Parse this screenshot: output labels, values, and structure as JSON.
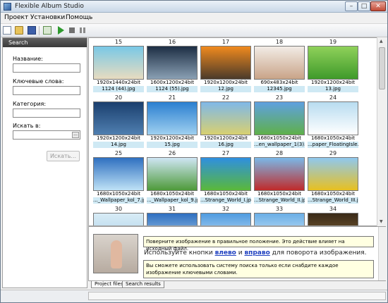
{
  "window": {
    "title": "Flexible Album Studio"
  },
  "menu": [
    "Проект",
    "Установки",
    "Помощь"
  ],
  "sidebar": {
    "header": "Search",
    "fields": [
      {
        "label": "Название:",
        "value": ""
      },
      {
        "label": "Ключевые слова:",
        "value": ""
      },
      {
        "label": "Категория:",
        "value": ""
      },
      {
        "label": "Искать в:",
        "value": ""
      }
    ],
    "browse_label": "...",
    "search_button": "Искать..."
  },
  "gallery": {
    "rows": [
      [
        {
          "num": "15",
          "meta": "1920x1440x24bit",
          "name": "1124 (44).jpg",
          "colors": [
            "#79c8e6",
            "#e8dcc0"
          ]
        },
        {
          "num": "16",
          "meta": "1600x1200x24bit",
          "name": "1124 (55).jpg",
          "colors": [
            "#1d2e44",
            "#8aa0b4"
          ]
        },
        {
          "num": "17",
          "meta": "1920x1200x24bit",
          "name": "12.jpg",
          "colors": [
            "#f08a1e",
            "#4a3a2a"
          ]
        },
        {
          "num": "18",
          "meta": "690x483x24bit",
          "name": "12345.jpg",
          "colors": [
            "#f2ece6",
            "#c9a488"
          ]
        },
        {
          "num": "19",
          "meta": "1920x1200x24bit",
          "name": "13.jpg",
          "colors": [
            "#8fd15a",
            "#3f9a2a"
          ]
        }
      ],
      [
        {
          "num": "20",
          "meta": "1920x1200x24bit",
          "name": "14.jpg",
          "colors": [
            "#1b3f6e",
            "#4f7fb0"
          ]
        },
        {
          "num": "21",
          "meta": "1920x1200x24bit",
          "name": "15.jpg",
          "colors": [
            "#2b7fd0",
            "#9fd0f0"
          ]
        },
        {
          "num": "22",
          "meta": "1920x1200x24bit",
          "name": "16.jpg",
          "colors": [
            "#7fb8e8",
            "#d8d070"
          ]
        },
        {
          "num": "23",
          "meta": "1680x1050x24bit",
          "name": "...en_wallpaper_1(3).jpg",
          "colors": [
            "#5fa0e0",
            "#5fb04a"
          ]
        },
        {
          "num": "24",
          "meta": "1680x1050x24bit",
          "name": "...paper_FloatingIsle.jpg",
          "colors": [
            "#b8dcf0",
            "#ffffff"
          ]
        }
      ],
      [
        {
          "num": "25",
          "meta": "1680x1050x24bit",
          "name": "..._Wallpaper_kol_7.jpg",
          "colors": [
            "#2f70c0",
            "#bfe2f6"
          ]
        },
        {
          "num": "26",
          "meta": "1680x1050x24bit",
          "name": "..._Wallpaper_kol_9.jpg",
          "colors": [
            "#cfe6f4",
            "#4e9a3a"
          ]
        },
        {
          "num": "27",
          "meta": "1680x1050x24bit",
          "name": "...Strange_World_I.jpg",
          "colors": [
            "#2f8fe0",
            "#5ab83a"
          ]
        },
        {
          "num": "28",
          "meta": "1680x1050x24bit",
          "name": "...Strange_World_II.jpg",
          "colors": [
            "#7ab8e8",
            "#c02a2a"
          ]
        },
        {
          "num": "29",
          "meta": "1680x1050x24bit",
          "name": "...Strange_World_III.jpg",
          "colors": [
            "#8fc8ef",
            "#e8c020"
          ]
        }
      ],
      [
        {
          "num": "30",
          "meta": "",
          "name": "",
          "colors": [
            "#d8ecf6",
            "#a8d0e8"
          ]
        },
        {
          "num": "31",
          "meta": "",
          "name": "",
          "colors": [
            "#2e6fc0",
            "#bcdcf0"
          ]
        },
        {
          "num": "32",
          "meta": "",
          "name": "",
          "colors": [
            "#4f9be0",
            "#d6eaf8"
          ]
        },
        {
          "num": "33",
          "meta": "",
          "name": "",
          "colors": [
            "#6aaee6",
            "#e0f0fa"
          ]
        },
        {
          "num": "34",
          "meta": "",
          "name": "",
          "colors": [
            "#3a2a18",
            "#8a6a3a"
          ]
        }
      ]
    ]
  },
  "info": {
    "tip1": "Поверните изображение в правильное положение. Это действие влияет на исходный файл.",
    "hint_pre": "Используйте кнопки ",
    "hint_left": "влево",
    "hint_mid": " и ",
    "hint_right": "вправо",
    "hint_post": " для поворота изображения.",
    "tip2": "Вы сможете использовать систему поиска только если снабдите каждое изображение ключевыми словами."
  },
  "tabs": [
    "Project files",
    "Search results"
  ]
}
